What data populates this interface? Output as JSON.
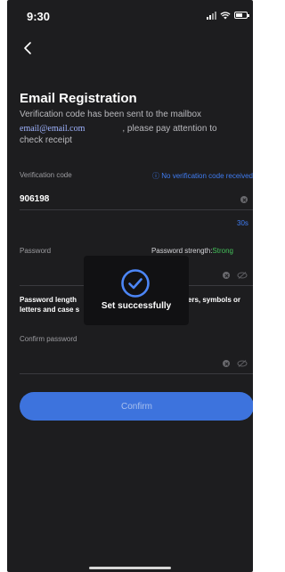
{
  "status_bar": {
    "time": "9:30",
    "icons": [
      "cellular-signal-icon",
      "wifi-icon",
      "battery-icon"
    ]
  },
  "nav": {
    "back_icon": "chevron-left-icon"
  },
  "page": {
    "title": "Email Registration",
    "subtitle": "Verification code has been sent to the mailbox",
    "email": "email@email.com",
    "subtitle_tail": ", please pay attention to",
    "subtitle_end": "check receipt"
  },
  "verification": {
    "label": "Verification code",
    "help_link": "ⓘ No verification code received",
    "value": "906198",
    "countdown": "30s",
    "clear_icon": "clear-icon"
  },
  "password": {
    "label": "Password",
    "strength_label": "Password strength:",
    "strength_value": "Strong",
    "hint_left": "Password length",
    "hint_right": "bers, symbols or",
    "hint_line2": "letters and case s",
    "icons": [
      "clear-icon",
      "eye-off-icon"
    ]
  },
  "confirm_password": {
    "label": "Confirm password",
    "icons": [
      "clear-icon",
      "eye-off-icon"
    ]
  },
  "confirm_button": {
    "label": "Confirm"
  },
  "toast": {
    "message": "Set successfully",
    "icon": "check-circle-icon"
  },
  "colors": {
    "background": "#1d1d1f",
    "accent": "#3f7cf2",
    "success": "#44c05a",
    "button": "#3d73dd"
  }
}
